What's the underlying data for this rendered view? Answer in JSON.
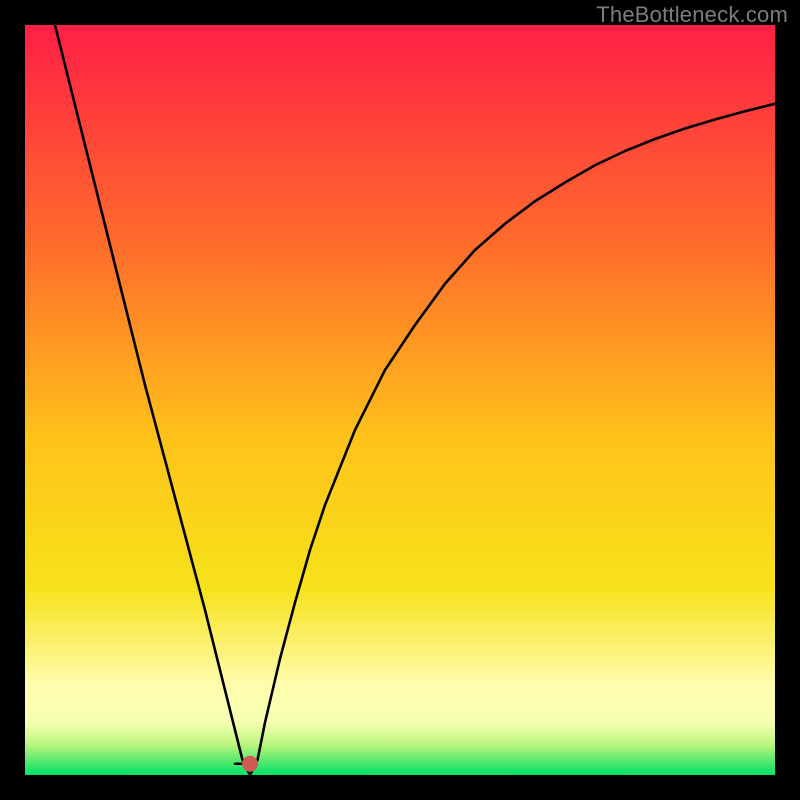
{
  "watermark": "TheBottleneck.com",
  "chart_data": {
    "type": "line",
    "title": "",
    "xlabel": "",
    "ylabel": "",
    "xlim": [
      0,
      100
    ],
    "ylim": [
      0,
      100
    ],
    "grid": false,
    "legend": false,
    "background_gradient": [
      "#ff1f46",
      "#ff9a1f",
      "#f7e21a",
      "#fff6a8",
      "#00e268"
    ],
    "series": [
      {
        "name": "curve",
        "color": "#000000",
        "x": [
          4,
          6,
          8,
          10,
          12,
          14,
          16,
          18,
          20,
          22,
          24,
          26,
          27,
          28,
          29,
          30,
          31,
          32,
          34,
          36,
          38,
          40,
          44,
          48,
          52,
          56,
          60,
          64,
          68,
          72,
          76,
          80,
          84,
          88,
          92,
          96,
          100
        ],
        "y": [
          100,
          92,
          84,
          76,
          68,
          60,
          52,
          44.5,
          37,
          29.5,
          22,
          14,
          10,
          6,
          2,
          0,
          2,
          7,
          15.5,
          23,
          30,
          36,
          46,
          54,
          60,
          65.5,
          70,
          73.5,
          76.5,
          79,
          81.3,
          83.2,
          84.8,
          86.2,
          87.4,
          88.5,
          89.5
        ]
      },
      {
        "name": "plateau",
        "color": "#000000",
        "x": [
          28,
          30
        ],
        "y": [
          1.5,
          1.5
        ]
      }
    ],
    "marker": {
      "name": "dot",
      "x": 30,
      "y": 1.5,
      "color": "#cf5a52",
      "radius_px": 8
    }
  }
}
